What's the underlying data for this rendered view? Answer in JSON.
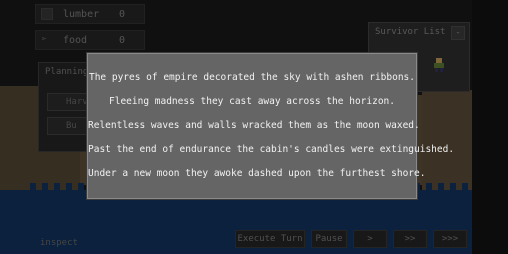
{
  "resources": [
    {
      "label": "lumber",
      "value": "0",
      "icon": "lumber-icon"
    },
    {
      "label": "food",
      "value": "0",
      "icon": "food-icon"
    }
  ],
  "planning": {
    "title": "Planning",
    "buttons": [
      "Harv",
      "Bu"
    ]
  },
  "survivor_list": {
    "title": "Survivor List",
    "toggle": "-"
  },
  "story": {
    "lines": [
      "The pyres of empire decorated the sky with ashen ribbons.",
      "Fleeing madness they cast away across the horizon.",
      "Relentless waves and walls wracked them as the moon waxed.",
      "Past the end of endurance the cabin's candles were extinguished.",
      "Under a new moon they awoke dashed upon the furthest shore."
    ]
  },
  "bottom": {
    "inspect": "inspect",
    "execute_turn": "Execute Turn",
    "pause": "Pause",
    "speed1": ">",
    "speed2": ">>",
    "speed3": ">>>"
  },
  "colors": {
    "dialog_bg": "#656565",
    "water": "#14396b",
    "land": "#6b5a42"
  }
}
